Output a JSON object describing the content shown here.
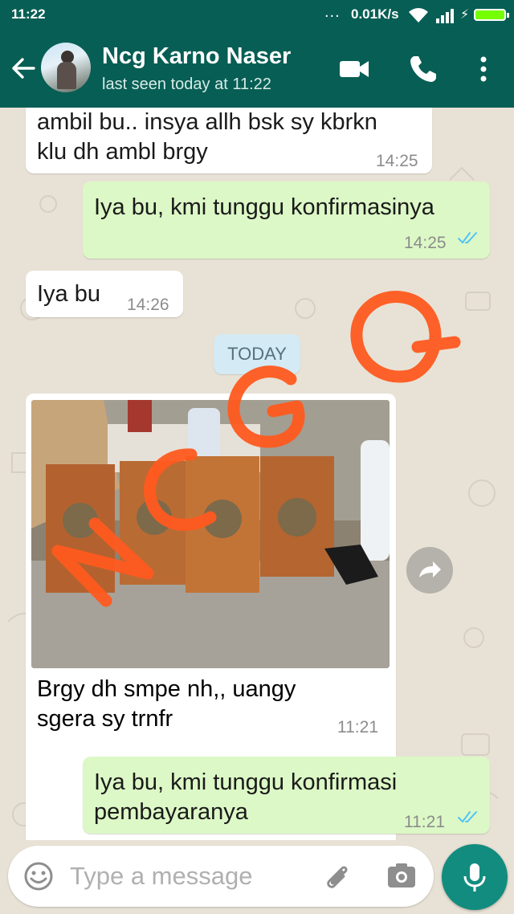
{
  "status_bar": {
    "time": "11:22",
    "dots": "...",
    "network_speed": "0.01K/s"
  },
  "header": {
    "contact_name": "Ncg Karno Naser",
    "last_seen": "last seen today at 11:22"
  },
  "chat": {
    "messages": [
      {
        "direction": "incoming",
        "lines": [
          "ambil bu.. insya allh bsk sy kbrkn",
          "klu dh ambl brgy"
        ],
        "time": "14:25"
      },
      {
        "direction": "outgoing",
        "lines": [
          "Iya bu, kmi tunggu konfirmasinya"
        ],
        "time": "14:25",
        "status": "read"
      },
      {
        "direction": "incoming",
        "lines": [
          "Iya bu"
        ],
        "time": "14:26"
      },
      {
        "direction": "incoming",
        "type": "image",
        "caption_lines": [
          "Brgy dh smpe nh,, uangy",
          "sgera sy trnfr"
        ],
        "time": "11:21"
      },
      {
        "direction": "outgoing",
        "lines": [
          "Iya bu, kmi tunggu konfirmasi",
          "pembayaranya"
        ],
        "time": "11:21",
        "status": "read"
      }
    ],
    "date_divider": "TODAY",
    "watermark": "NCG Q"
  },
  "input": {
    "placeholder": "Type a message"
  },
  "colors": {
    "header": "#075e54",
    "outgoing_bubble": "#dcf8c6",
    "incoming_bubble": "#ffffff",
    "chat_background": "#e8e2d6",
    "read_ticks": "#4fc3f7",
    "watermark": "#ff5a1f",
    "mic_button": "#128c7e"
  },
  "icons": [
    "back-arrow-icon",
    "video-call-icon",
    "phone-icon",
    "more-options-icon",
    "forward-icon",
    "emoji-icon",
    "attachment-icon",
    "camera-icon",
    "microphone-icon",
    "wifi-icon",
    "signal-icon",
    "battery-icon"
  ]
}
